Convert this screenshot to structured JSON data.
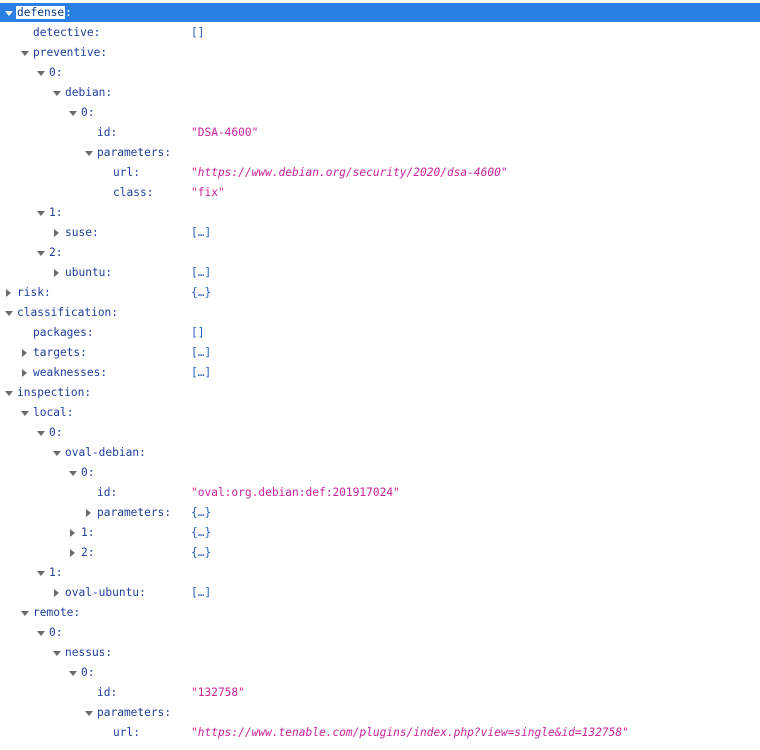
{
  "rows": [
    {
      "key": "defense",
      "value": "",
      "kind": "none",
      "twisty": "open",
      "selected": true
    },
    {
      "key": "detective",
      "value": "[]",
      "kind": "sum",
      "twisty": "none"
    },
    {
      "key": "preventive",
      "value": "",
      "kind": "none",
      "twisty": "open"
    },
    {
      "key": "0",
      "value": "",
      "kind": "none",
      "twisty": "open"
    },
    {
      "key": "debian",
      "value": "",
      "kind": "none",
      "twisty": "open"
    },
    {
      "key": "0",
      "value": "",
      "kind": "none",
      "twisty": "open"
    },
    {
      "key": "id",
      "value": "\"DSA-4600\"",
      "kind": "str",
      "twisty": "none"
    },
    {
      "key": "parameters",
      "value": "",
      "kind": "none",
      "twisty": "open"
    },
    {
      "key": "url",
      "value": "\"https://www.debian.org/security/2020/dsa-4600\"",
      "kind": "str-link",
      "twisty": "none"
    },
    {
      "key": "class",
      "value": "\"fix\"",
      "kind": "str",
      "twisty": "none"
    },
    {
      "key": "1",
      "value": "",
      "kind": "none",
      "twisty": "open"
    },
    {
      "key": "suse",
      "value": "[…]",
      "kind": "sum",
      "twisty": "closed"
    },
    {
      "key": "2",
      "value": "",
      "kind": "none",
      "twisty": "open"
    },
    {
      "key": "ubuntu",
      "value": "[…]",
      "kind": "sum",
      "twisty": "closed"
    },
    {
      "key": "risk",
      "value": "{…}",
      "kind": "sum",
      "twisty": "closed"
    },
    {
      "key": "classification",
      "value": "",
      "kind": "none",
      "twisty": "open"
    },
    {
      "key": "packages",
      "value": "[]",
      "kind": "sum",
      "twisty": "none"
    },
    {
      "key": "targets",
      "value": "[…]",
      "kind": "sum",
      "twisty": "closed"
    },
    {
      "key": "weaknesses",
      "value": "[…]",
      "kind": "sum",
      "twisty": "closed"
    },
    {
      "key": "inspection",
      "value": "",
      "kind": "none",
      "twisty": "open"
    },
    {
      "key": "local",
      "value": "",
      "kind": "none",
      "twisty": "open"
    },
    {
      "key": "0",
      "value": "",
      "kind": "none",
      "twisty": "open"
    },
    {
      "key": "oval-debian",
      "value": "",
      "kind": "none",
      "twisty": "open"
    },
    {
      "key": "0",
      "value": "",
      "kind": "none",
      "twisty": "open"
    },
    {
      "key": "id",
      "value": "\"oval:org.debian:def:201917024\"",
      "kind": "str",
      "twisty": "none"
    },
    {
      "key": "parameters",
      "value": "{…}",
      "kind": "sum",
      "twisty": "closed"
    },
    {
      "key": "1",
      "value": "{…}",
      "kind": "sum",
      "twisty": "closed"
    },
    {
      "key": "2",
      "value": "{…}",
      "kind": "sum",
      "twisty": "closed"
    },
    {
      "key": "1",
      "value": "",
      "kind": "none",
      "twisty": "open"
    },
    {
      "key": "oval-ubuntu",
      "value": "[…]",
      "kind": "sum",
      "twisty": "closed"
    },
    {
      "key": "remote",
      "value": "",
      "kind": "none",
      "twisty": "open"
    },
    {
      "key": "0",
      "value": "",
      "kind": "none",
      "twisty": "open"
    },
    {
      "key": "nessus",
      "value": "",
      "kind": "none",
      "twisty": "open"
    },
    {
      "key": "0",
      "value": "",
      "kind": "none",
      "twisty": "open"
    },
    {
      "key": "id",
      "value": "\"132758\"",
      "kind": "str",
      "twisty": "none"
    },
    {
      "key": "parameters",
      "value": "",
      "kind": "none",
      "twisty": "open"
    },
    {
      "key": "url",
      "value": "\"https://www.tenable.com/plugins/index.php?view=single&id=132758\"",
      "kind": "str-link",
      "twisty": "none"
    }
  ]
}
